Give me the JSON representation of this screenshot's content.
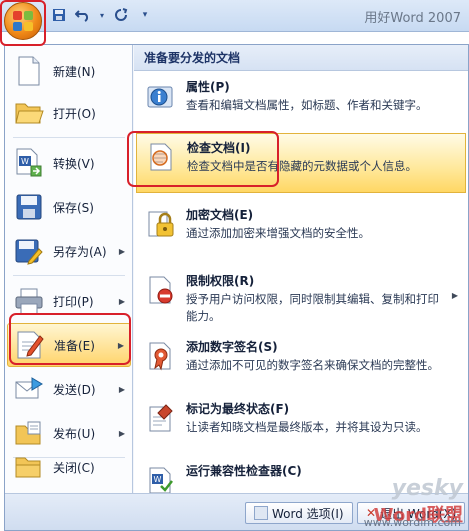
{
  "window": {
    "title": "用好Word 2007"
  },
  "qat": {
    "save_icon": "save-icon",
    "undo_icon": "undo-icon",
    "redo_icon": "redo-icon",
    "customize_icon": "customize-icon"
  },
  "left_menu": [
    {
      "label": "新建(N)",
      "icon": "new-document-icon"
    },
    {
      "label": "打开(O)",
      "icon": "open-folder-icon"
    },
    {
      "label": "转换(V)",
      "icon": "convert-icon"
    },
    {
      "label": "保存(S)",
      "icon": "save-disk-icon"
    },
    {
      "label": "另存为(A)",
      "icon": "save-as-icon",
      "arrow": "▶"
    },
    {
      "label": "打印(P)",
      "icon": "printer-icon",
      "arrow": "▶"
    },
    {
      "label": "准备(E)",
      "icon": "prepare-icon",
      "arrow": "▶"
    },
    {
      "label": "发送(D)",
      "icon": "send-icon",
      "arrow": "▶"
    },
    {
      "label": "发布(U)",
      "icon": "publish-icon",
      "arrow": "▶"
    },
    {
      "label": "关闭(C)",
      "icon": "close-folder-icon"
    }
  ],
  "right_panel": {
    "header": "准备要分发的文档",
    "items": [
      {
        "title": "属性(P)",
        "desc": "查看和编辑文档属性，如标题、作者和关键字。",
        "icon": "properties-icon"
      },
      {
        "title": "检查文档(I)",
        "desc": "检查文档中是否有隐藏的元数据或个人信息。",
        "icon": "inspect-document-icon"
      },
      {
        "title": "加密文档(E)",
        "desc": "通过添加加密来增强文档的安全性。",
        "icon": "encrypt-lock-icon"
      },
      {
        "title": "限制权限(R)",
        "desc": "授予用户访问权限，同时限制其编辑、复制和打印能力。",
        "icon": "restrict-permission-icon",
        "arrow": "▶"
      },
      {
        "title": "添加数字签名(S)",
        "desc": "通过添加不可见的数字签名来确保文档的完整性。",
        "icon": "digital-signature-icon"
      },
      {
        "title": "标记为最终状态(F)",
        "desc": "让读者知晓文档是最终版本，并将其设为只读。",
        "icon": "mark-final-icon"
      },
      {
        "title": "运行兼容性检查器(C)",
        "desc": "",
        "icon": "compatibility-checker-icon"
      }
    ]
  },
  "bottom": {
    "options_label": "Word 选项(I)",
    "exit_label": "退出 Word(X)"
  },
  "watermark": {
    "brand": "yesky",
    "brand2": "Word联盟",
    "url": "www.wordlm.com"
  }
}
